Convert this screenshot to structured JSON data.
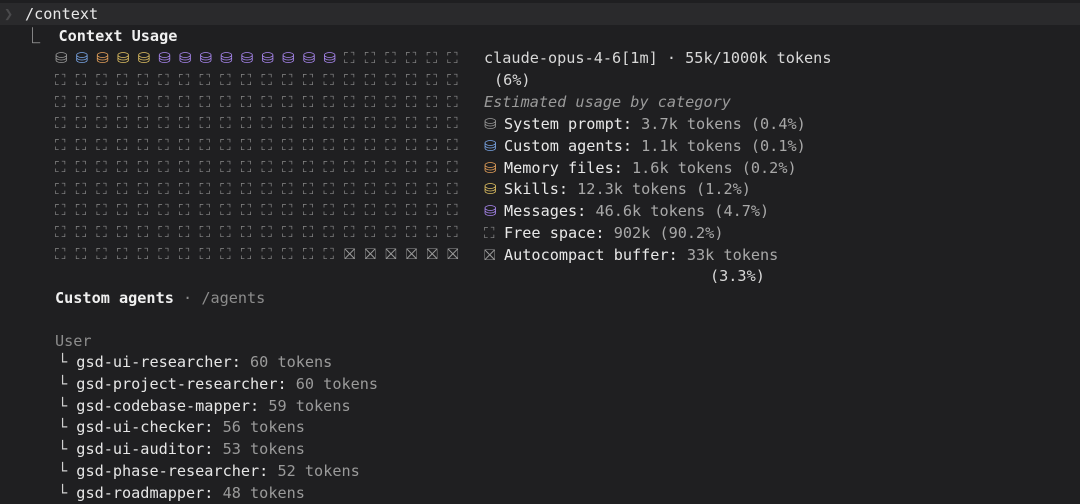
{
  "command": "/context",
  "title": "Context Usage",
  "model_line": "claude-opus-4-6[1m] · 55k/1000k tokens",
  "model_pct": "(6%)",
  "estimated_header": "Estimated usage by category",
  "colors": {
    "system": "#9a9a9a",
    "custom_agents": "#7aa7e8",
    "memory": "#e6a15a",
    "skills": "#e0c062",
    "messages": "#a987f0",
    "free": "#8a8a8a",
    "buffer": "#9a9a9a"
  },
  "grid": {
    "rows": [
      [
        "system",
        "custom_agents",
        "memory",
        "skills",
        "skills",
        "messages",
        "messages",
        "messages",
        "messages",
        "messages",
        "messages",
        "messages",
        "messages",
        "messages",
        "free",
        "free",
        "free",
        "free",
        "free",
        "free"
      ],
      [
        "free",
        "free",
        "free",
        "free",
        "free",
        "free",
        "free",
        "free",
        "free",
        "free",
        "free",
        "free",
        "free",
        "free",
        "free",
        "free",
        "free",
        "free",
        "free",
        "free"
      ],
      [
        "free",
        "free",
        "free",
        "free",
        "free",
        "free",
        "free",
        "free",
        "free",
        "free",
        "free",
        "free",
        "free",
        "free",
        "free",
        "free",
        "free",
        "free",
        "free",
        "free"
      ],
      [
        "free",
        "free",
        "free",
        "free",
        "free",
        "free",
        "free",
        "free",
        "free",
        "free",
        "free",
        "free",
        "free",
        "free",
        "free",
        "free",
        "free",
        "free",
        "free",
        "free"
      ],
      [
        "free",
        "free",
        "free",
        "free",
        "free",
        "free",
        "free",
        "free",
        "free",
        "free",
        "free",
        "free",
        "free",
        "free",
        "free",
        "free",
        "free",
        "free",
        "free",
        "free"
      ],
      [
        "free",
        "free",
        "free",
        "free",
        "free",
        "free",
        "free",
        "free",
        "free",
        "free",
        "free",
        "free",
        "free",
        "free",
        "free",
        "free",
        "free",
        "free",
        "free",
        "free"
      ],
      [
        "free",
        "free",
        "free",
        "free",
        "free",
        "free",
        "free",
        "free",
        "free",
        "free",
        "free",
        "free",
        "free",
        "free",
        "free",
        "free",
        "free",
        "free",
        "free",
        "free"
      ],
      [
        "free",
        "free",
        "free",
        "free",
        "free",
        "free",
        "free",
        "free",
        "free",
        "free",
        "free",
        "free",
        "free",
        "free",
        "free",
        "free",
        "free",
        "free",
        "free",
        "free"
      ],
      [
        "free",
        "free",
        "free",
        "free",
        "free",
        "free",
        "free",
        "free",
        "free",
        "free",
        "free",
        "free",
        "free",
        "free",
        "free",
        "free",
        "free",
        "free",
        "free",
        "free"
      ],
      [
        "free",
        "free",
        "free",
        "free",
        "free",
        "free",
        "free",
        "free",
        "free",
        "free",
        "free",
        "free",
        "free",
        "free",
        "buffer",
        "buffer",
        "buffer",
        "buffer",
        "buffer",
        "buffer"
      ]
    ]
  },
  "symbols": {
    "used": "⛁",
    "free": "⛶",
    "buffer": "⛝"
  },
  "categories": [
    {
      "key": "system",
      "label": "System prompt:",
      "value": "3.7k tokens (0.4%)"
    },
    {
      "key": "custom_agents",
      "label": "Custom agents:",
      "value": "1.1k tokens (0.1%)"
    },
    {
      "key": "memory",
      "label": "Memory files:",
      "value": "1.6k tokens (0.2%)"
    },
    {
      "key": "skills",
      "label": "Skills:",
      "value": "12.3k tokens (1.2%)"
    },
    {
      "key": "messages",
      "label": "Messages:",
      "value": "46.6k tokens (4.7%)"
    },
    {
      "key": "free",
      "label": "Free space:",
      "value": "902k (90.2%)"
    },
    {
      "key": "buffer",
      "label": "Autocompact buffer:",
      "value": "33k tokens"
    }
  ],
  "buffer_pct": "(3.3%)",
  "custom_agents_section": {
    "title": "Custom agents",
    "path": "/agents",
    "group": "User",
    "agents": [
      {
        "name": "gsd-ui-researcher:",
        "tokens": "60 tokens"
      },
      {
        "name": "gsd-project-researcher:",
        "tokens": "60 tokens"
      },
      {
        "name": "gsd-codebase-mapper:",
        "tokens": "59 tokens"
      },
      {
        "name": "gsd-ui-checker:",
        "tokens": "56 tokens"
      },
      {
        "name": "gsd-ui-auditor:",
        "tokens": "53 tokens"
      },
      {
        "name": "gsd-phase-researcher:",
        "tokens": "52 tokens"
      },
      {
        "name": "gsd-roadmapper:",
        "tokens": "48 tokens"
      }
    ]
  }
}
